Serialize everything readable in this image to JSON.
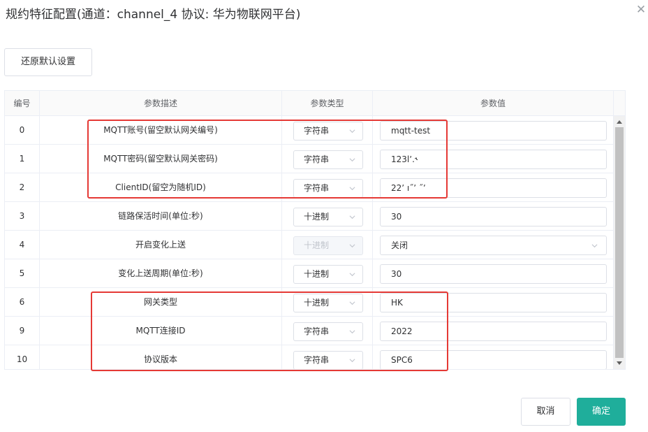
{
  "dialog": {
    "title": "规约特征配置(通道：channel_4 协议: 华为物联网平台)",
    "close_icon": "close-icon"
  },
  "toolbar": {
    "reset_label": "还原默认设置"
  },
  "table": {
    "headers": [
      "编号",
      "参数描述",
      "参数类型",
      "参数值"
    ],
    "rows": [
      {
        "id": "0",
        "desc": "MQTT账号(留空默认网关编号)",
        "type": "字符串",
        "value": "mqtt-test"
      },
      {
        "id": "1",
        "desc": "MQTT密码(留空默认网关密码)",
        "type": "字符串",
        "value": "123lʼ․˞"
      },
      {
        "id": "2",
        "desc": "ClientID(留空为随机ID)",
        "type": "字符串",
        "value": "22ʼ ı˝ʼ ˝ʼ"
      },
      {
        "id": "3",
        "desc": "链路保活时间(单位:秒)",
        "type": "十进制",
        "value": "30"
      },
      {
        "id": "4",
        "desc": "开启变化上送",
        "type": "十进制",
        "value": "关闭",
        "type_disabled": true,
        "value_select": true
      },
      {
        "id": "5",
        "desc": "变化上送周期(单位:秒)",
        "type": "十进制",
        "value": "30"
      },
      {
        "id": "6",
        "desc": "网关类型",
        "type": "十进制",
        "value": "HK"
      },
      {
        "id": "9",
        "desc": "MQTT连接ID",
        "type": "字符串",
        "value": "2022"
      },
      {
        "id": "10",
        "desc": "协议版本",
        "type": "字符串",
        "value": "SPC6"
      }
    ]
  },
  "footer": {
    "cancel_label": "取消",
    "ok_label": "确定"
  },
  "colors": {
    "primary": "#1fae9b",
    "highlight": "#e53935",
    "border": "#dcdfe6"
  }
}
